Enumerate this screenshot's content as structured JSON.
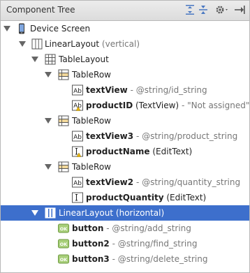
{
  "header": {
    "title": "Component Tree"
  },
  "tree": {
    "device_screen": "Device Screen",
    "linear_vertical": {
      "name": "LinearLayout",
      "detail": "(vertical)"
    },
    "table_layout": {
      "name": "TableLayout"
    },
    "table_row_1": {
      "name": "TableRow"
    },
    "text_view": {
      "name": "textView",
      "detail": "- @string/id_string"
    },
    "product_id": {
      "name": "productID",
      "type": "(TextView)",
      "detail": "- \"Not assigned\""
    },
    "table_row_2": {
      "name": "TableRow"
    },
    "text_view3": {
      "name": "textView3",
      "detail": "- @string/product_string"
    },
    "product_name": {
      "name": "productName",
      "type": "(EditText)"
    },
    "table_row_3": {
      "name": "TableRow"
    },
    "text_view2": {
      "name": "textView2",
      "detail": "- @string/quantity_string"
    },
    "product_quantity": {
      "name": "productQuantity",
      "type": "(EditText)"
    },
    "linear_horizontal": {
      "name": "LinearLayout",
      "detail": "(horizontal)"
    },
    "button": {
      "name": "button",
      "detail": "- @string/add_string"
    },
    "button2": {
      "name": "button2",
      "detail": "- @string/find_string"
    },
    "button3": {
      "name": "button3",
      "detail": "- @string/delete_string"
    }
  },
  "icons": {
    "ab_text": "Ab",
    "ok_button": "OK"
  },
  "colors": {
    "selection": "#3d6fcc",
    "warning": "#e8b400"
  }
}
